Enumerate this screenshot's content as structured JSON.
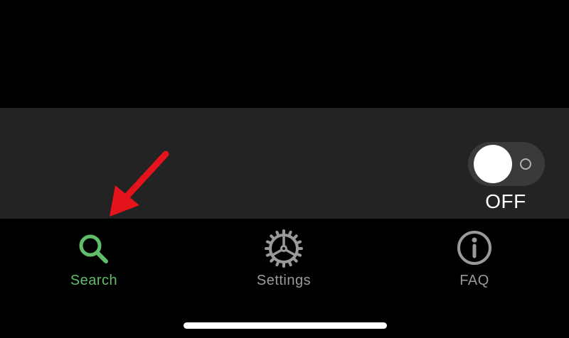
{
  "toggle": {
    "state_label": "OFF",
    "on": false
  },
  "tab_bar": {
    "tabs": [
      {
        "label": "Search",
        "icon": "search-icon",
        "active": true
      },
      {
        "label": "Settings",
        "icon": "gear-icon",
        "active": false
      },
      {
        "label": "FAQ",
        "icon": "info-icon",
        "active": false
      }
    ]
  },
  "colors": {
    "background": "#000000",
    "panel": "#232323",
    "active_tab": "#62bd6a",
    "inactive_tab": "#9a9a9a",
    "annotation_arrow": "#e5141c"
  }
}
